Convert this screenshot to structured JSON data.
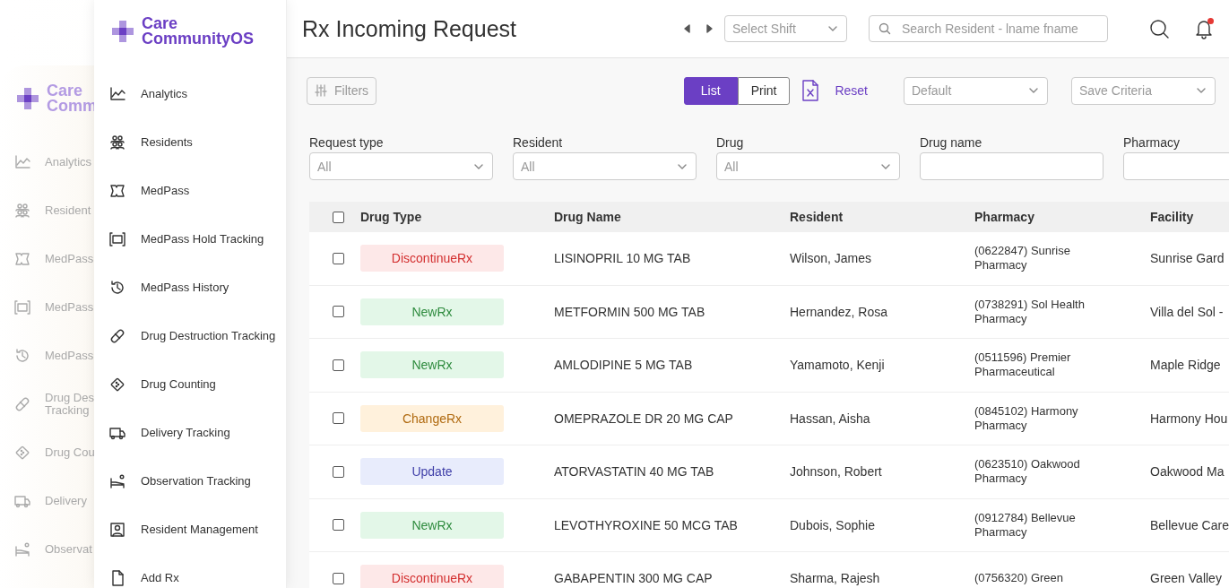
{
  "ghost_sidebar": {
    "logo": [
      "Care",
      "Comm"
    ],
    "items": [
      {
        "label": "Analytics"
      },
      {
        "label": "Resident"
      },
      {
        "label": "MedPass"
      },
      {
        "label": "MedPass"
      },
      {
        "label": "MedPass"
      },
      {
        "label": "Drug Des Tracking"
      },
      {
        "label": "Drug Cou"
      },
      {
        "label": "Delivery"
      },
      {
        "label": "Observat"
      }
    ]
  },
  "sidebar": {
    "logo": [
      "Care",
      "CommunityOS"
    ],
    "items": [
      {
        "label": "Analytics"
      },
      {
        "label": "Residents"
      },
      {
        "label": "MedPass"
      },
      {
        "label": "MedPass Hold Tracking"
      },
      {
        "label": "MedPass History"
      },
      {
        "label": "Drug Destruction Tracking"
      },
      {
        "label": "Drug Counting"
      },
      {
        "label": "Delivery Tracking"
      },
      {
        "label": "Observation Tracking"
      },
      {
        "label": "Resident Management"
      },
      {
        "label": "Add Rx"
      }
    ]
  },
  "header": {
    "title": "Rx Incoming Request",
    "shift_select": {
      "placeholder": "Select Shift"
    },
    "search": {
      "placeholder": "Search Resident - lname fname"
    },
    "notifications": {
      "unread": true
    }
  },
  "toolbar": {
    "filters_button": "Filters",
    "view_toggle": [
      {
        "label": "List",
        "selected": true
      },
      {
        "label": "Print",
        "selected": false
      }
    ],
    "reset": "Reset",
    "preset_select": {
      "placeholder": "Default"
    },
    "save_criteria": {
      "placeholder": "Save Criteria"
    }
  },
  "filters": [
    {
      "label": "Request type",
      "kind": "select",
      "placeholder": "All"
    },
    {
      "label": "Resident",
      "kind": "select",
      "placeholder": "All"
    },
    {
      "label": "Drug",
      "kind": "select",
      "placeholder": "All"
    },
    {
      "label": "Drug name",
      "kind": "text"
    },
    {
      "label": "Pharmacy",
      "kind": "text"
    }
  ],
  "table": {
    "select_all_checked": false,
    "columns": [
      "Drug Type",
      "Drug Name",
      "Resident",
      "Pharmacy",
      "Facility"
    ],
    "rows": [
      {
        "checked": false,
        "drug_type": {
          "label": "DiscontinueRx",
          "kind": "discontinue"
        },
        "drug_name": "LISINOPRIL 10 MG TAB",
        "resident": "Wilson, James",
        "pharmacy": "(0622847) Sunrise Pharmacy",
        "facility": "Sunrise Gard"
      },
      {
        "checked": false,
        "drug_type": {
          "label": "NewRx",
          "kind": "new"
        },
        "drug_name": "METFORMIN 500 MG TAB",
        "resident": "Hernandez, Rosa",
        "pharmacy": "(0738291) Sol Health Pharmacy",
        "facility": "Villa del Sol -"
      },
      {
        "checked": false,
        "drug_type": {
          "label": "NewRx",
          "kind": "new"
        },
        "drug_name": "AMLODIPINE 5 MG TAB",
        "resident": "Yamamoto, Kenji",
        "pharmacy": "(0511596) Premier Pharmaceutical",
        "facility": "Maple Ridge"
      },
      {
        "checked": false,
        "drug_type": {
          "label": "ChangeRx",
          "kind": "change"
        },
        "drug_name": "OMEPRAZOLE DR 20 MG CAP",
        "resident": "Hassan, Aisha",
        "pharmacy": "(0845102) Harmony Pharmacy",
        "facility": "Harmony Hou"
      },
      {
        "checked": false,
        "drug_type": {
          "label": "Update",
          "kind": "update"
        },
        "drug_name": "ATORVASTATIN 40 MG TAB",
        "resident": "Johnson, Robert",
        "pharmacy": "(0623510) Oakwood Pharmacy",
        "facility": "Oakwood Ma"
      },
      {
        "checked": false,
        "drug_type": {
          "label": "NewRx",
          "kind": "new"
        },
        "drug_name": "LEVOTHYROXINE 50 MCG TAB",
        "resident": "Dubois, Sophie",
        "pharmacy": "(0912784) Bellevue Pharmacy",
        "facility": "Bellevue Care"
      },
      {
        "checked": false,
        "drug_type": {
          "label": "DiscontinueRx",
          "kind": "discontinue"
        },
        "drug_name": "GABAPENTIN 300 MG CAP",
        "resident": "Sharma, Rajesh",
        "pharmacy": "(0756320) Green",
        "facility": "Green Valley"
      }
    ]
  }
}
